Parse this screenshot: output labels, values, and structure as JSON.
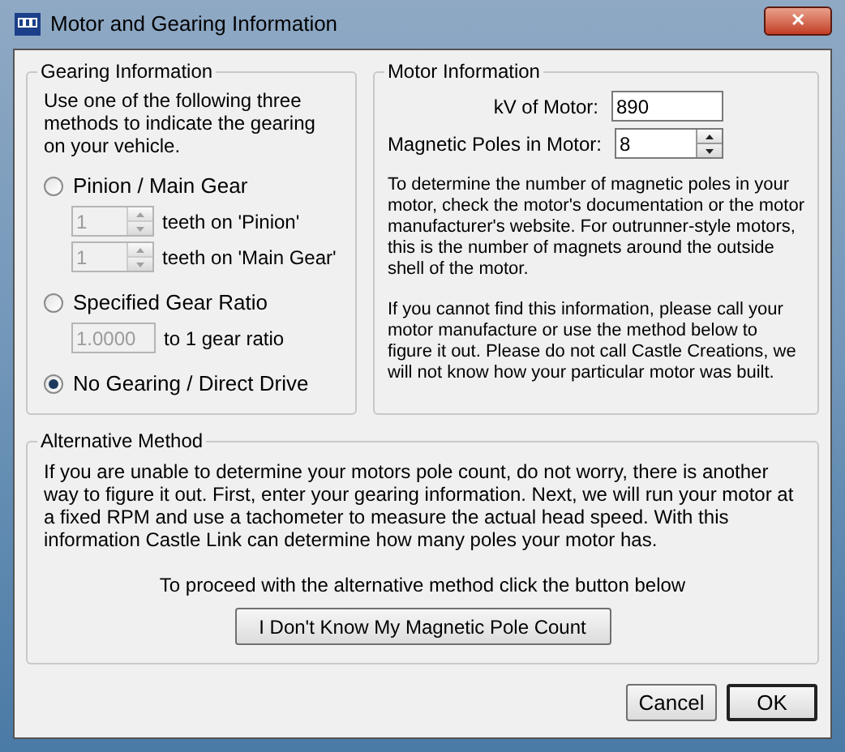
{
  "window": {
    "title": "Motor and Gearing Information",
    "close": "✕"
  },
  "gearing": {
    "title": "Gearing Information",
    "intro": "Use one of the following three methods to indicate the gearing on your vehicle.",
    "options": [
      {
        "label": "Pinion / Main Gear",
        "selected": false,
        "fields": [
          {
            "kind": "spinner",
            "value": "1",
            "label": "teeth on 'Pinion'",
            "disabled": true
          },
          {
            "kind": "spinner",
            "value": "1",
            "label": "teeth on 'Main Gear'",
            "disabled": true
          }
        ]
      },
      {
        "label": "Specified Gear Ratio",
        "selected": false,
        "fields": [
          {
            "kind": "textbox",
            "value": "1.0000",
            "label": "to 1 gear ratio",
            "disabled": true
          }
        ]
      },
      {
        "label": "No Gearing / Direct Drive",
        "selected": true
      }
    ]
  },
  "motor": {
    "title": "Motor Information",
    "fields": [
      {
        "kind": "textbox",
        "label": "kV of Motor:",
        "value": "890",
        "disabled": false
      },
      {
        "kind": "spinner",
        "label": "Magnetic Poles in Motor:",
        "value": "8",
        "disabled": false
      }
    ],
    "paragraphs": [
      "To determine the number of magnetic poles in your motor, check the motor's documentation or the motor manufacturer's website.  For outrunner-style motors, this is the number of magnets around the outside shell of the motor.",
      "If you cannot find this information, please call your motor manufacture or use the method below to figure it out.  Please do not call Castle Creations, we will not know how your particular motor was built."
    ]
  },
  "alternative": {
    "title": "Alternative Method",
    "description": "If you are unable to determine your motors pole count, do not worry, there is another way to figure it out.  First, enter your gearing information.  Next, we will run your motor at a fixed RPM and use a tachometer to measure the actual head speed.  With this information Castle Link can determine how many poles your motor has.",
    "prompt": "To proceed with the alternative method click the button below",
    "button": "I Don't Know My Magnetic Pole Count"
  },
  "buttons": [
    {
      "label": "Cancel",
      "default": false
    },
    {
      "label": "OK",
      "default": true
    }
  ]
}
